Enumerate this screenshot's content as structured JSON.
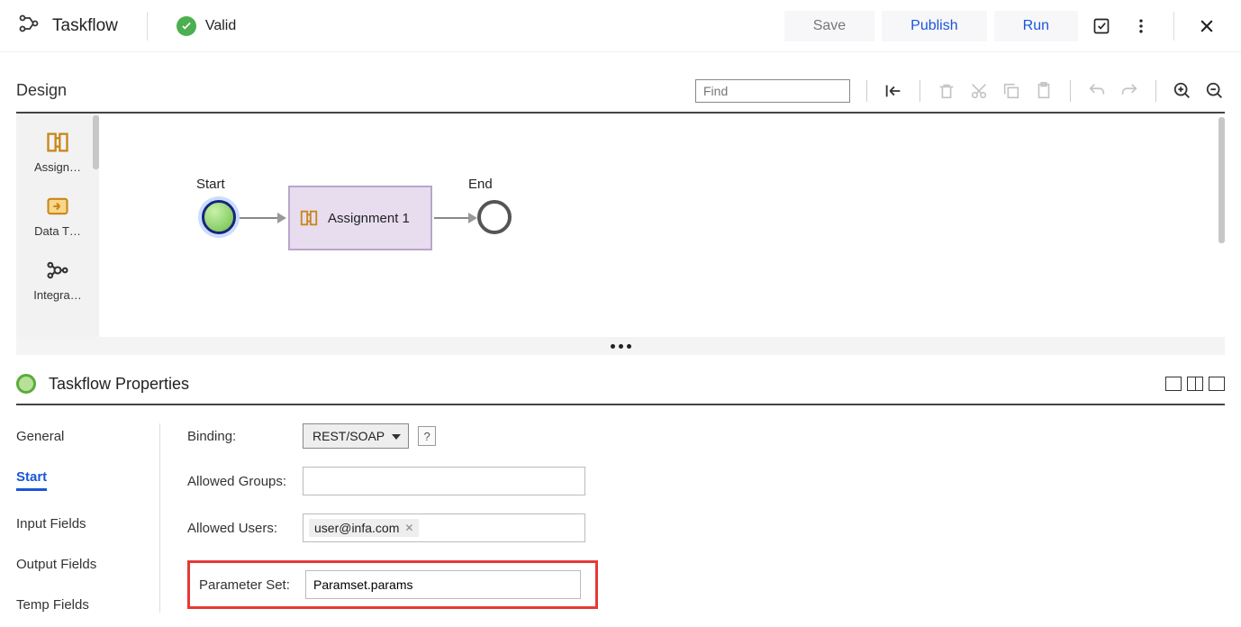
{
  "header": {
    "app_title": "Taskflow",
    "status": "Valid",
    "save_label": "Save",
    "publish_label": "Publish",
    "run_label": "Run"
  },
  "design": {
    "title": "Design",
    "find_placeholder": "Find",
    "palette": [
      {
        "label": "Assign…"
      },
      {
        "label": "Data T…"
      },
      {
        "label": "Integra…"
      }
    ],
    "nodes": {
      "start_label": "Start",
      "assignment_label": "Assignment 1",
      "end_label": "End"
    }
  },
  "properties": {
    "title": "Taskflow Properties",
    "tabs": [
      "General",
      "Start",
      "Input Fields",
      "Output Fields",
      "Temp Fields"
    ],
    "active_tab": "Start",
    "form": {
      "binding_label": "Binding:",
      "binding_value": "REST/SOAP",
      "allowed_groups_label": "Allowed Groups:",
      "allowed_groups_value": "",
      "allowed_users_label": "Allowed Users:",
      "allowed_users_tag": "user@infa.com",
      "parameter_set_label": "Parameter Set:",
      "parameter_set_value": "Paramset.params"
    }
  }
}
